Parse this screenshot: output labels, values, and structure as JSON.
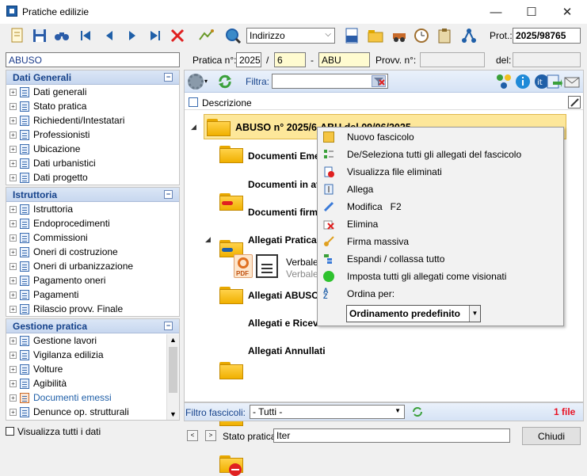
{
  "window": {
    "title": "Pratiche edilizie",
    "min": "—",
    "max": "☐",
    "close": "✕"
  },
  "toolbar": {
    "search_field": "Indirizzo",
    "prot_label": "Prot.:",
    "prot_value": "2025/98765"
  },
  "search_row": {
    "left_value": "ABUSO",
    "pratica_label": "Pratica n°:",
    "year": "2025",
    "sep": "/",
    "number": "6",
    "dash": "-",
    "code": "ABU",
    "provv_label": "Provv. n°:",
    "provv_value": "",
    "del_label": "del:",
    "del_value": ""
  },
  "sidebar": {
    "dati_generali": {
      "title": "Dati Generali",
      "items": [
        "Dati generali",
        "Stato pratica",
        "Richiedenti/Intestatari",
        "Professionisti",
        "Ubicazione",
        "Dati urbanistici",
        "Dati progetto"
      ]
    },
    "istruttoria": {
      "title": "Istruttoria",
      "items": [
        "Istruttoria",
        "Endoprocedimenti",
        "Commissioni",
        "Oneri di costruzione",
        "Oneri di urbanizzazione",
        "Pagamento oneri",
        "Pagamenti",
        "Rilascio provv. Finale"
      ]
    },
    "gestione": {
      "title": "Gestione pratica",
      "items": [
        "Gestione lavori",
        "Vigilanza edilizia",
        "Volture",
        "Agibilità",
        "Documenti emessi",
        "Denunce op. strutturali"
      ]
    },
    "show_all": "Visualizza tutti i dati"
  },
  "docs": {
    "filter_label": "Filtra:",
    "filter_value": "",
    "column_header": "Descrizione",
    "root": "ABUSO n° 2025/6-ABU del 09/06/2025",
    "items": [
      "Documenti Emessi",
      "Documenti in attesa",
      "Documenti firmati",
      "Allegati Pratica",
      "Allegati ABUSO",
      "Allegati e Ricevute",
      "Allegati Annullati"
    ],
    "file_name": "Verbale_",
    "file_sub": "Verbale"
  },
  "context_menu": {
    "items": [
      "Nuovo fascicolo",
      "De/Seleziona tutti gli allegati del fascicolo",
      "Visualizza file eliminati",
      "Allega",
      "Modifica   F2",
      "Elimina",
      "Firma massiva",
      "Espandi / collassa tutto",
      "Imposta tutti gli allegati come visionati",
      "Ordina per:"
    ],
    "sort_value": "Ordinamento predefinito"
  },
  "footer": {
    "filtro_label": "Filtro fascicoli:",
    "filtro_value": "- Tutti -",
    "file_count": "1 file",
    "stato_label": "Stato pratica:",
    "stato_value": "Iter",
    "close_button": "Chiudi"
  },
  "colors": {
    "accent": "#1f5fa8",
    "panel_header": "#15428b",
    "error": "#e81123",
    "selected_row": "#fde79a"
  }
}
